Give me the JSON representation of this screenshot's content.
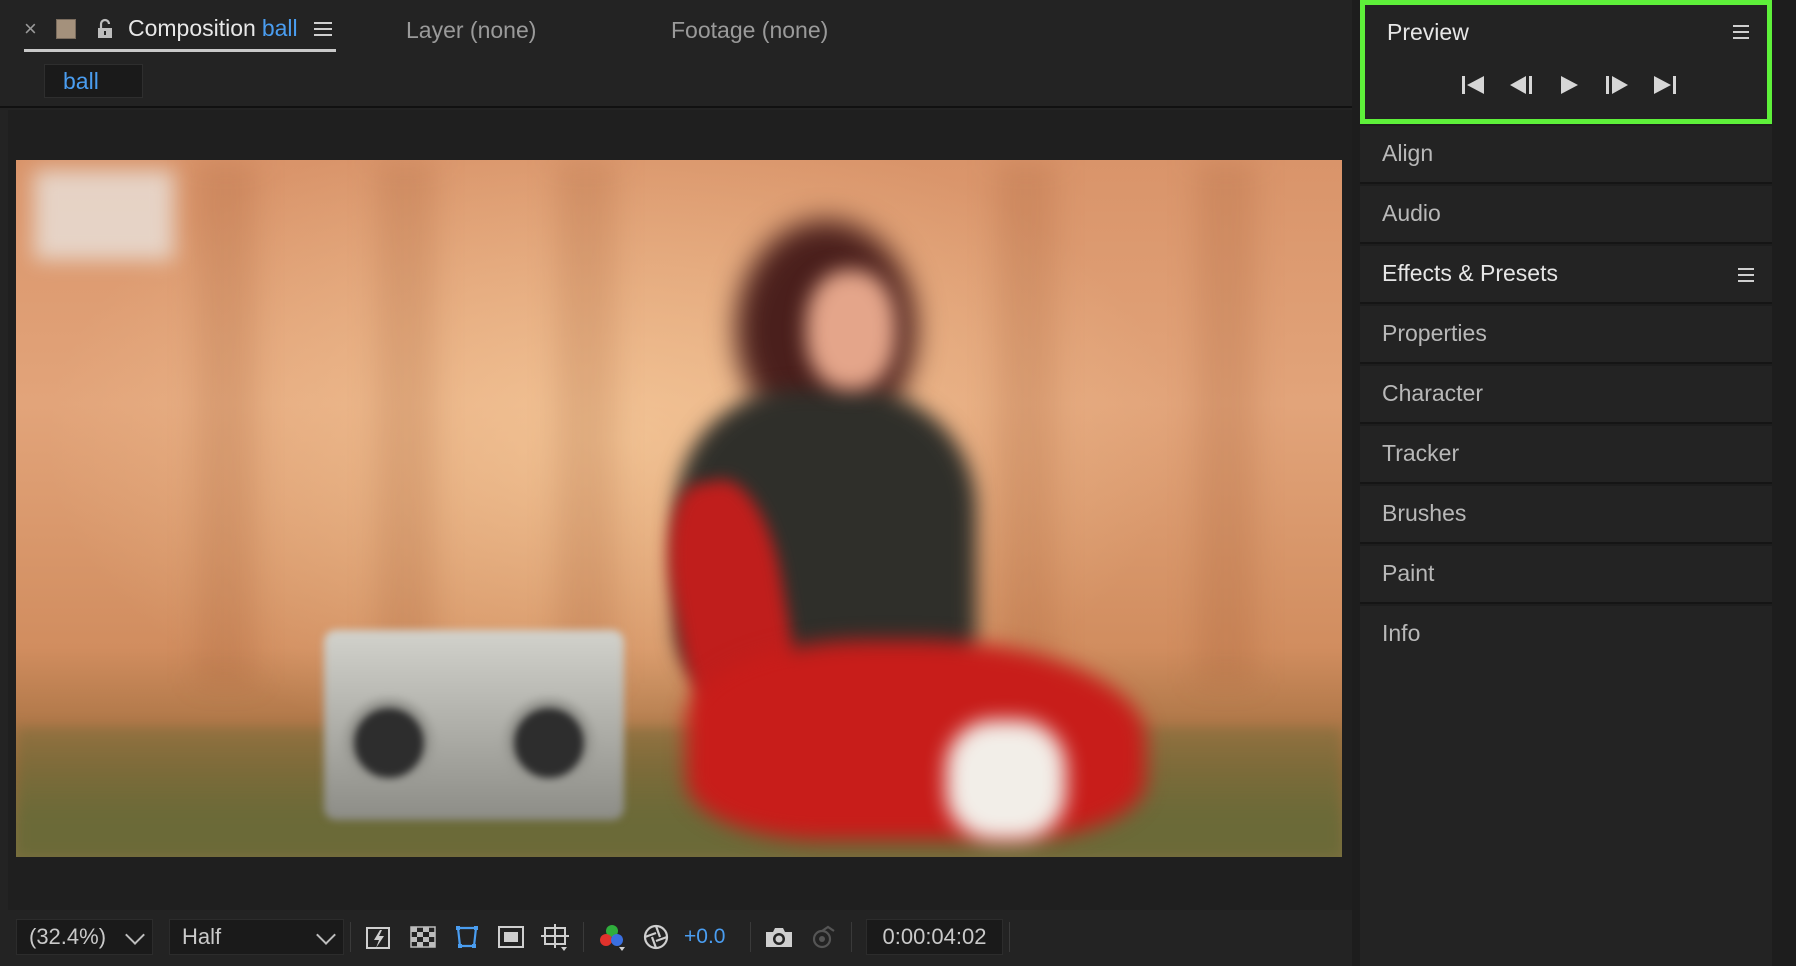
{
  "composition_tab": {
    "close_label": "×",
    "title": "Composition",
    "name": "ball"
  },
  "layer_tab": {
    "label": "Layer (none)"
  },
  "footage_tab": {
    "label": "Footage (none)"
  },
  "flowchart": {
    "chip_label": "ball"
  },
  "viewer_controls": {
    "zoom": "(32.4%)",
    "resolution": "Half",
    "exposure": "+0.0",
    "timecode": "0:00:04:02"
  },
  "icons": {
    "fast_previews": "fast-previews-icon",
    "transparency_grid": "transparency-grid-icon",
    "mask_visibility": "mask-visibility-icon",
    "region_of_interest": "region-of-interest-icon",
    "guides": "guides-icon",
    "channels": "color-channels-icon",
    "color_management": "color-management-icon",
    "snapshot": "camera-icon",
    "show_snapshot": "show-snapshot-icon"
  },
  "preview_panel": {
    "title": "Preview",
    "transport": [
      "first-frame",
      "previous-frame",
      "play",
      "next-frame",
      "last-frame"
    ],
    "highlight_color": "#5ef03a"
  },
  "panels": [
    {
      "label": "Align"
    },
    {
      "label": "Audio"
    },
    {
      "label": "Effects & Presets"
    },
    {
      "label": "Properties"
    },
    {
      "label": "Character"
    },
    {
      "label": "Tracker"
    },
    {
      "label": "Brushes"
    },
    {
      "label": "Paint"
    },
    {
      "label": "Info"
    }
  ],
  "accent_color": "#4a9df0"
}
